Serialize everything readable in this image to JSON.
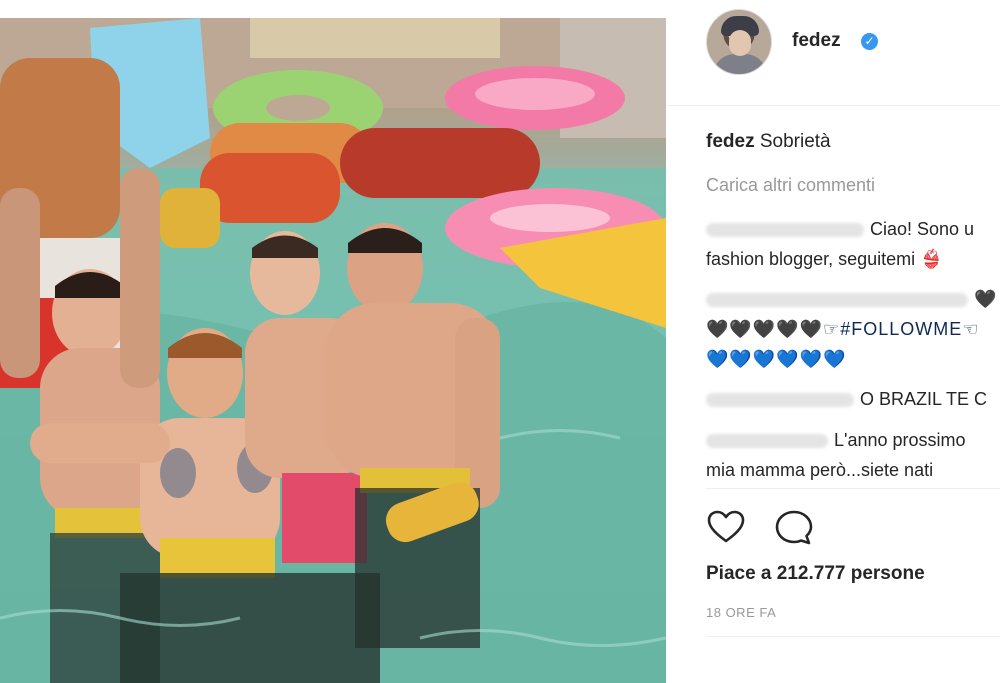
{
  "post": {
    "author": "fedez",
    "caption_author": "fedez",
    "caption_text": "Sobrietà",
    "load_more_label": "Carica altri commenti",
    "likes_text": "Piace a 212.777 persone",
    "timestamp": "18 ORE FA"
  },
  "comments": [
    {
      "line1": "Ciao! Sono u",
      "line2": "fashion blogger, seguitemi 👙"
    },
    {
      "line1": "🖤",
      "line2": "🖤🖤🖤🖤🖤☞#FOLLOWME☜",
      "line3": "💙💙💙💙💙💙"
    },
    {
      "line1": "O BRAZIL TE C"
    },
    {
      "line1": "L'anno prossimo",
      "line2": "mia mamma però...siete nati"
    }
  ],
  "icons": {
    "like": "heart-outline-icon",
    "comment": "speech-bubble-icon",
    "verified": "verified-badge-icon"
  },
  "colors": {
    "verified_blue": "#3897f0",
    "text": "#262626",
    "muted": "#999999"
  }
}
